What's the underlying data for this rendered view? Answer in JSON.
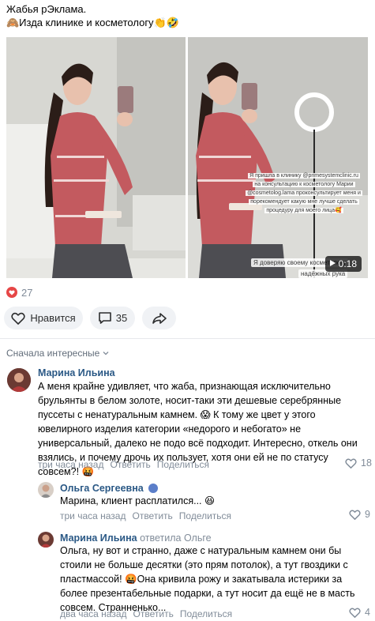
{
  "post": {
    "title": "Жабья рЭклама.",
    "subtitle": "🙈Изда клинике и косметологу👏🤣"
  },
  "media": {
    "right_overlay_lines": [
      "Я пришла в клинику @primesystemclinic.ru",
      "на консультацию к косметологу Марии",
      "@cosmetolog.lama проконсультирует меня и",
      "порекомендует какую мне лучше сделать",
      "процедуру для моего лица🥰"
    ],
    "bottom_caption_1": "Я доверяю своему косметологу",
    "bottom_caption_2": "надёжных рука",
    "duration": "0:18"
  },
  "likes": {
    "count": "27"
  },
  "actions": {
    "like_label": "Нравится",
    "comment_count": "35"
  },
  "sort": {
    "label": "Сначала интересные"
  },
  "comments": [
    {
      "author": "Марина Ильина",
      "text": "А меня крайне удивляет, что жаба, признающая исключительно брульянты в белом золоте, носит-таки эти дешевые серебрянные пуссеты с ненатуральным камнем. 😱 К тому же цвет у этого ювелирного изделия категории «недорого и небогато» не универсальный, далеко не подо всё подходит. Интересно, откель они взялись, и почему дрочь их пользует, хотя они ей не по статусу совсем?! 🤬",
      "time": "три часа назад",
      "reply": "Ответить",
      "share": "Поделиться",
      "likes": "18"
    },
    {
      "author": "Ольга Сергеевна",
      "text": "Марина, клиент расплатился... 😆",
      "time": "три часа назад",
      "reply": "Ответить",
      "share": "Поделиться",
      "likes": "9"
    },
    {
      "author": "Марина Ильина",
      "replied_to": "ответила Ольге",
      "text": "Ольга, ну вот и странно, даже с натуральным камнем они бы стоили не больше десятки (это прям потолок), а тут гвоздики с пластмассой! 🤬Она кривила рожу и закатывала истерики за более презентабельные подарки, а тут носит да ещё не в масть совсем. Странненько...",
      "time": "два часа назад",
      "reply": "Ответить",
      "share": "Поделиться",
      "likes": "4"
    }
  ],
  "colors": {
    "link": "#2a5885",
    "muted": "#818c99",
    "heart": "#e64646",
    "button_bg": "#f0f2f5"
  }
}
